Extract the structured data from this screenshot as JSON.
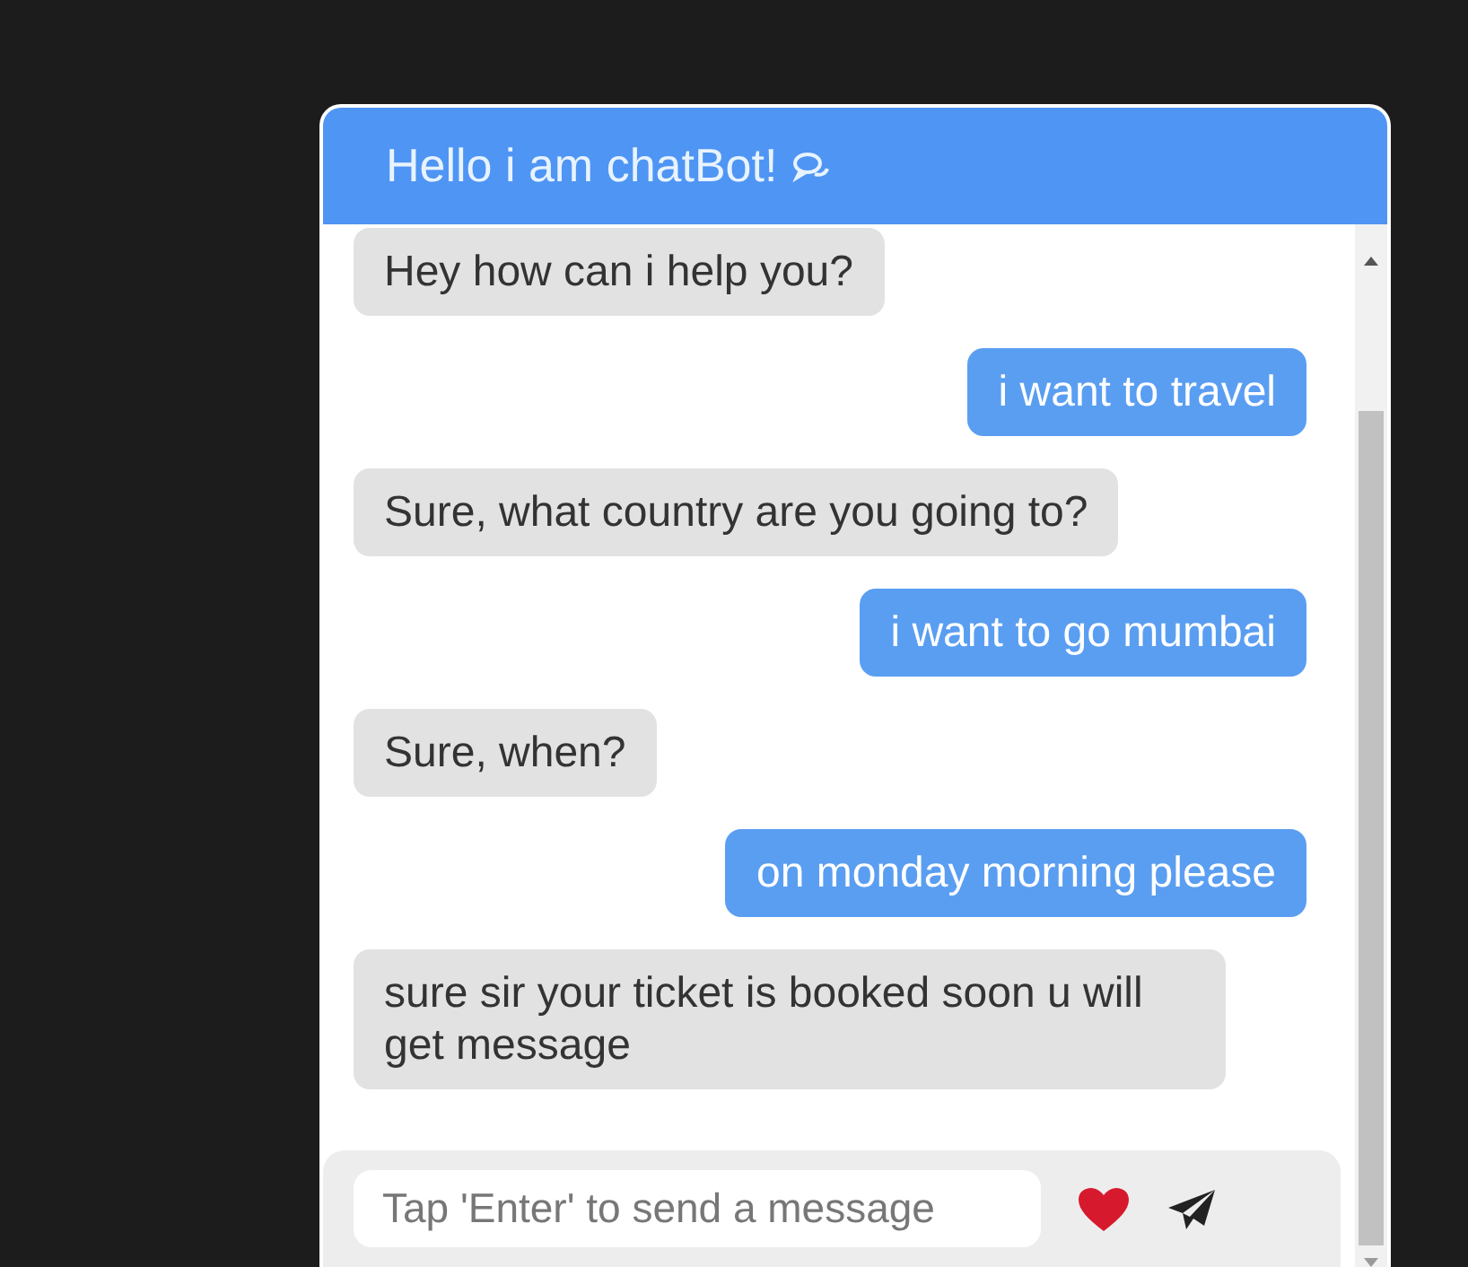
{
  "header": {
    "title": "Hello i am chatBot!"
  },
  "messages": [
    {
      "kind": "bot",
      "text": "Hey how can i help you?"
    },
    {
      "kind": "user",
      "text": "i want to travel"
    },
    {
      "kind": "bot",
      "text": "Sure, what country are you going to?"
    },
    {
      "kind": "user",
      "text": "i want to go mumbai"
    },
    {
      "kind": "bot",
      "text": "Sure, when?"
    },
    {
      "kind": "user",
      "text": "on monday morning please"
    },
    {
      "kind": "bot",
      "text": "sure sir your ticket is booked soon u will get message"
    }
  ],
  "composer": {
    "placeholder": "Tap 'Enter' to send a message"
  }
}
